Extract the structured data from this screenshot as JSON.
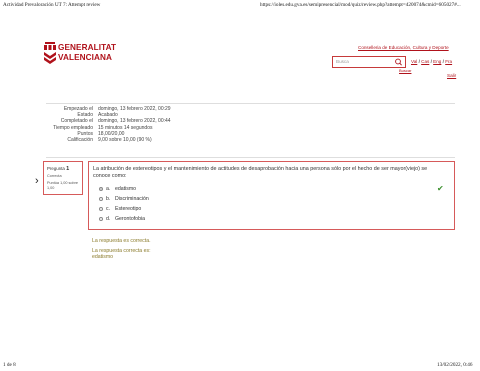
{
  "print_header": {
    "title": "Actividad Prevaloración UT 7: Attempt review",
    "url": "https://ioles.edu.gva.es/semipresencial/mod/quiz/review.php?attempt=420074&cmid=605027#..."
  },
  "print_footer": {
    "page": "1 de 8",
    "datetime": "13/02/2022, 0:46"
  },
  "header": {
    "logo_line1": "GENERALITAT",
    "logo_line2": "VALENCIANA",
    "ministry_link": "Conselleria de Educación, Cultura y Deporte",
    "search_placeholder": "Busca",
    "search_sublabel": "Buscar",
    "lang_links": [
      "Val",
      "Cas",
      "Eng",
      "Fra"
    ],
    "exit_link": "Salir",
    "brand_color": "#b0121b"
  },
  "summary": {
    "rows": [
      {
        "label": "Empezado el",
        "value": "domingo, 13 febrero 2022, 00:29"
      },
      {
        "label": "Estado",
        "value": "Acabado"
      },
      {
        "label": "Completado el",
        "value": "domingo, 13 febrero 2022, 00:44"
      },
      {
        "label": "Tiempo empleado",
        "value": "15 minutos 14 segundos"
      },
      {
        "label": "Puntos",
        "value": "18,00/20,00"
      },
      {
        "label": "Calificación",
        "value": "9,00 sobre 10,00 (90 %)"
      }
    ]
  },
  "question_info": {
    "label": "Pregunta",
    "number": "1",
    "state": "Correcta",
    "points": "Puntúa 1,00 sobre 1,00"
  },
  "question": {
    "text": "La atribución de estereotipos y el mantenimiento de actitudes de desaprobación hacia una persona sólo por el hecho de ser mayor(viejo) se conoce como:",
    "answers": [
      {
        "letter": "a.",
        "text": "edatismo",
        "selected": true,
        "correct": true
      },
      {
        "letter": "b.",
        "text": "Discriminación",
        "selected": false
      },
      {
        "letter": "c.",
        "text": "Estereotipo",
        "selected": false
      },
      {
        "letter": "d.",
        "text": "Gerontofobia",
        "selected": false
      }
    ]
  },
  "feedback": {
    "line1": "La respuesta es correcta.",
    "line2a": "La respuesta correcta es:",
    "line2b": "edatismo"
  }
}
